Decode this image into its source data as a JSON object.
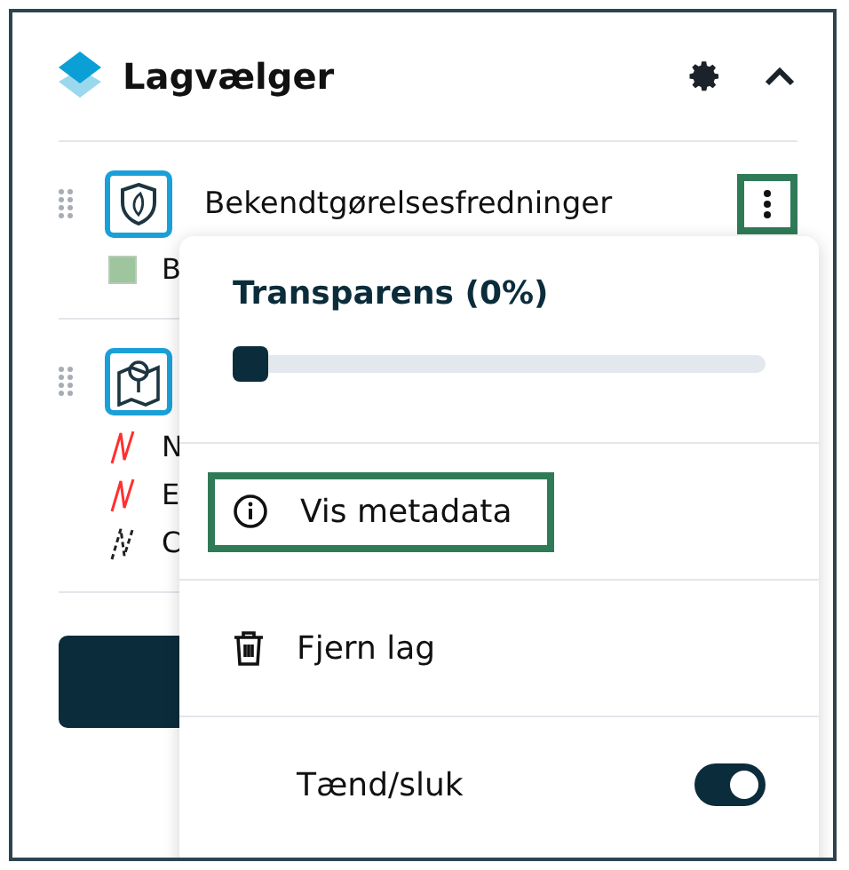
{
  "panel": {
    "title": "Lagvælger"
  },
  "layers": [
    {
      "name": "Bekendtgørelsesfredninger",
      "menu_highlighted": true,
      "legend": [
        {
          "kind": "swatch",
          "label": "B",
          "color": "#9ec59e"
        }
      ]
    },
    {
      "legend": [
        {
          "kind": "line",
          "label": "N",
          "color": "#ff3030"
        },
        {
          "kind": "line",
          "label": "E",
          "color": "#ff3030"
        },
        {
          "kind": "dashed",
          "label": "C",
          "color": "#222222"
        }
      ]
    }
  ],
  "menu": {
    "title": "Transparens (0%)",
    "level": 0,
    "items": [
      {
        "kind": "info",
        "label": "Vis metadata",
        "highlighted": true
      },
      {
        "kind": "trash",
        "label": "Fjern lag",
        "highlighted": false
      }
    ],
    "toggle": {
      "label": "Tænd/sluk",
      "on": true
    }
  }
}
